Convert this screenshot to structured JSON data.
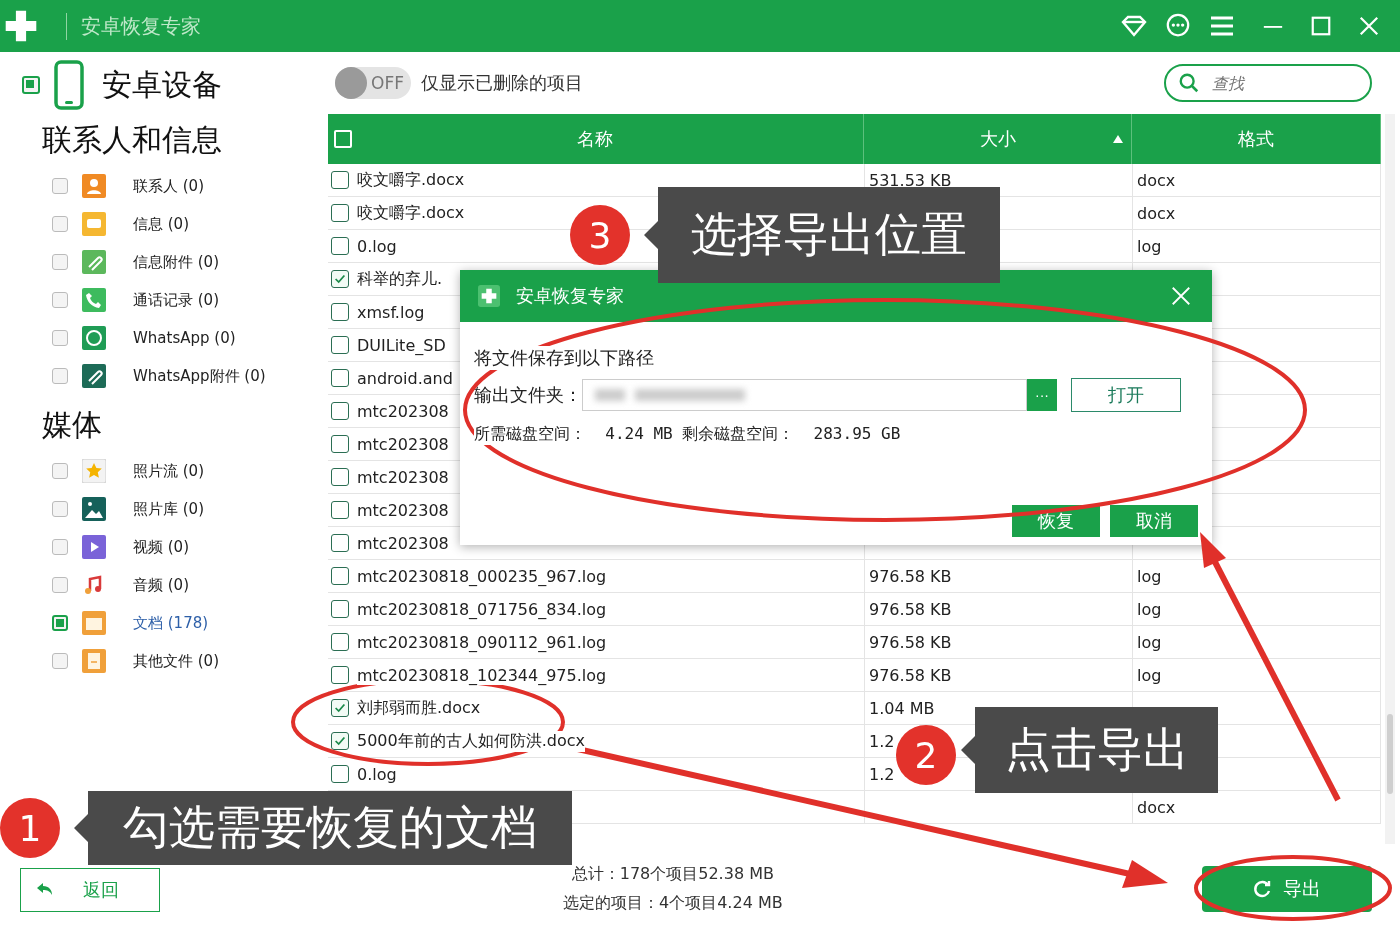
{
  "window": {
    "title": "安卓恢复专家"
  },
  "sidebar": {
    "device": {
      "label": "安卓设备",
      "checked": true
    },
    "groups": [
      {
        "title": "联系人和信息",
        "items": [
          {
            "kind": "contacts",
            "label": "联系人 (0)",
            "checked": false
          },
          {
            "kind": "messages",
            "label": "信息 (0)",
            "checked": false
          },
          {
            "kind": "attachments",
            "label": "信息附件 (0)",
            "checked": false
          },
          {
            "kind": "calls",
            "label": "通话记录 (0)",
            "checked": false
          },
          {
            "kind": "whatsapp",
            "label": "WhatsApp (0)",
            "checked": false
          },
          {
            "kind": "whatsapp-attach",
            "label": "WhatsApp附件 (0)",
            "checked": false
          }
        ]
      },
      {
        "title": "媒体",
        "items": [
          {
            "kind": "photostream",
            "label": "照片流 (0)",
            "checked": false
          },
          {
            "kind": "gallery",
            "label": "照片库 (0)",
            "checked": false
          },
          {
            "kind": "video",
            "label": "视频 (0)",
            "checked": false
          },
          {
            "kind": "audio",
            "label": "音频 (0)",
            "checked": false
          },
          {
            "kind": "documents",
            "label": "文档 (178)",
            "checked": true
          },
          {
            "kind": "other",
            "label": "其他文件 (0)",
            "checked": false
          }
        ]
      }
    ]
  },
  "filter": {
    "toggle_text": "OFF",
    "on": false,
    "label": "仅显示已删除的项目"
  },
  "search": {
    "placeholder": "查找"
  },
  "table": {
    "all_checked": false,
    "columns": [
      {
        "label": "名称",
        "sorted": false
      },
      {
        "label": "大小",
        "sorted": true
      },
      {
        "label": "格式",
        "sorted": false
      }
    ],
    "rows": [
      {
        "checked": false,
        "name": "咬文嚼字.docx",
        "size": "531.53 KB",
        "format": "docx"
      },
      {
        "checked": false,
        "name": "咬文嚼字.docx",
        "format": "docx"
      },
      {
        "checked": false,
        "name": "0.log",
        "format": "log"
      },
      {
        "checked": true,
        "name": "科举的弃儿."
      },
      {
        "checked": false,
        "name": "xmsf.log"
      },
      {
        "checked": false,
        "name": "DUILite_SD"
      },
      {
        "checked": false,
        "name": "android.and"
      },
      {
        "checked": false,
        "name": "mtc202308"
      },
      {
        "checked": false,
        "name": "mtc202308"
      },
      {
        "checked": false,
        "name": "mtc202308"
      },
      {
        "checked": false,
        "name": "mtc202308"
      },
      {
        "checked": false,
        "name": "mtc202308"
      },
      {
        "checked": false,
        "name": "mtc20230818_000235_967.log",
        "size": "976.58 KB",
        "format": "log"
      },
      {
        "checked": false,
        "name": "mtc20230818_071756_834.log",
        "size": "976.58 KB",
        "format": "log"
      },
      {
        "checked": false,
        "name": "mtc20230818_090112_961.log",
        "size": "976.58 KB",
        "format": "log"
      },
      {
        "checked": false,
        "name": "mtc20230818_102344_975.log",
        "size": "976.58 KB",
        "format": "log"
      },
      {
        "checked": true,
        "name": "刘邦弱而胜.docx",
        "size": "1.04 MB"
      },
      {
        "checked": true,
        "name": "5000年前的古人如何防洪.docx",
        "size": "1.2"
      },
      {
        "checked": false,
        "name": "0.log",
        "size": "1.2"
      },
      {
        "format": "docx"
      }
    ]
  },
  "dialog": {
    "title": "安卓恢复专家",
    "prompt": "将文件保存到以下路径",
    "folder_label": "输出文件夹：",
    "browse": "···",
    "open": "打开",
    "space": "所需磁盘空间：  4.24 MB 剩余磁盘空间：  283.95 GB",
    "buttons": [
      "恢复",
      "取消"
    ]
  },
  "footer": {
    "back": "返回",
    "total": "总计：178个项目52.38 MB",
    "selected": "选定的项目：4个项目4.24 MB",
    "export": "导出"
  },
  "annotations": [
    {
      "number": "3",
      "text": "选择导出位置"
    },
    {
      "number": "2",
      "text": "点击导出"
    },
    {
      "number": "1",
      "text": "勾选需要恢复的文档"
    }
  ]
}
